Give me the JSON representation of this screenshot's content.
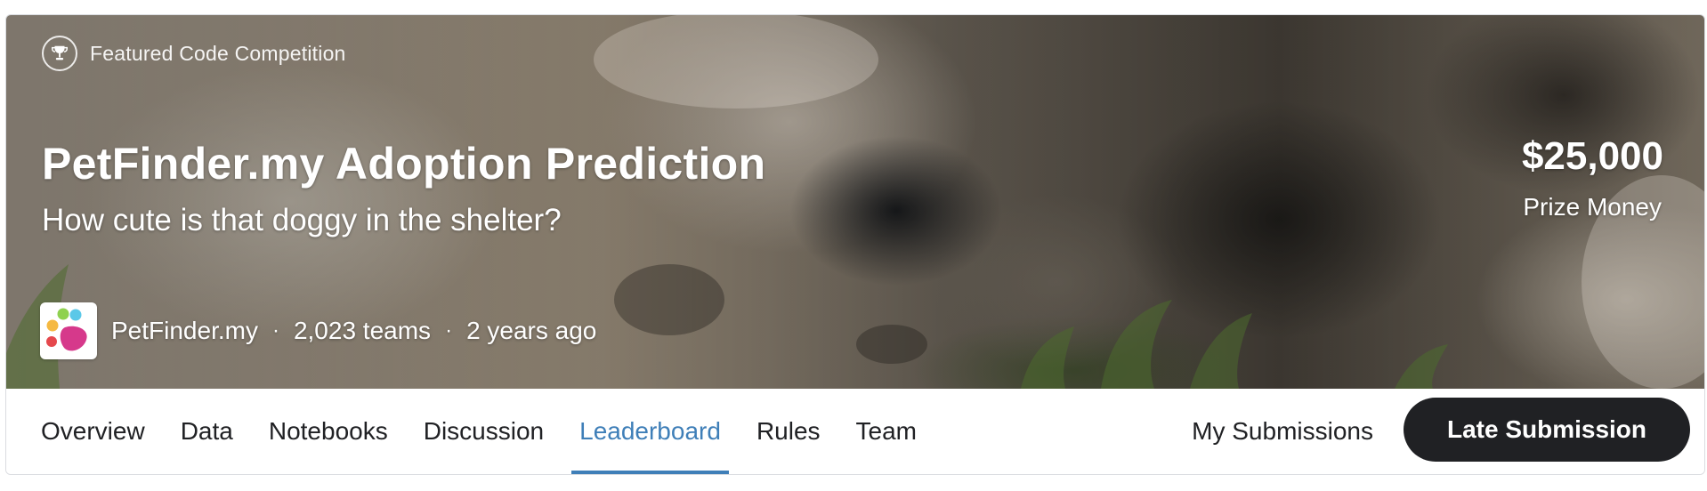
{
  "header": {
    "featured_label": "Featured Code Competition",
    "title": "PetFinder.my Adoption Prediction",
    "subtitle": "How cute is that doggy in the shelter?",
    "host": "PetFinder.my",
    "separator": "·",
    "teams": "2,023 teams",
    "time_ago": "2 years ago",
    "prize_amount": "$25,000",
    "prize_label": "Prize Money",
    "icons": {
      "featured": "trophy-icon",
      "host_logo": "petfinder-paw-logo"
    }
  },
  "nav": {
    "tabs": [
      {
        "label": "Overview"
      },
      {
        "label": "Data"
      },
      {
        "label": "Notebooks"
      },
      {
        "label": "Discussion"
      },
      {
        "label": "Leaderboard"
      },
      {
        "label": "Rules"
      },
      {
        "label": "Team"
      }
    ],
    "active_tab": "Leaderboard",
    "my_submissions": "My Submissions",
    "late_submission": "Late Submission"
  },
  "colors": {
    "accent": "#3f7fb8",
    "button_bg": "#202124",
    "text": "#202124"
  }
}
